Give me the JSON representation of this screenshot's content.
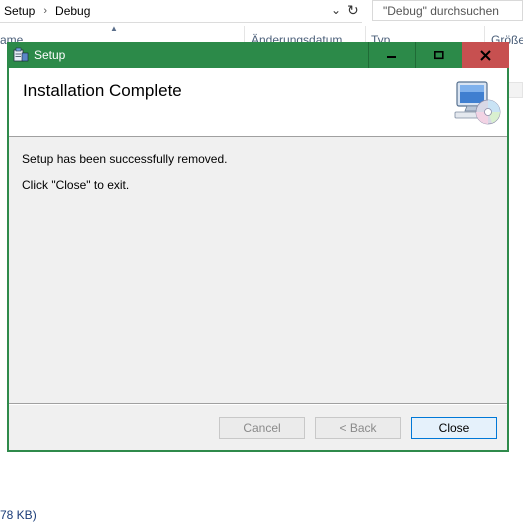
{
  "explorer": {
    "breadcrumb": [
      "Setup",
      "Debug"
    ],
    "search_placeholder": "\"Debug\" durchsuchen",
    "columns": {
      "name": "ame",
      "date": "Änderungsdatum",
      "type": "Typ",
      "size": "Größe"
    },
    "status_text": "78 KB)"
  },
  "dialog": {
    "title": "Setup",
    "banner_title": "Installation Complete",
    "message_line1": "Setup has been successfully removed.",
    "message_line2": "Click \"Close\" to exit.",
    "buttons": {
      "cancel": "Cancel",
      "back": "< Back",
      "close": "Close"
    },
    "titlebar_color": "#2c8a49",
    "close_button_color": "#c75050"
  }
}
